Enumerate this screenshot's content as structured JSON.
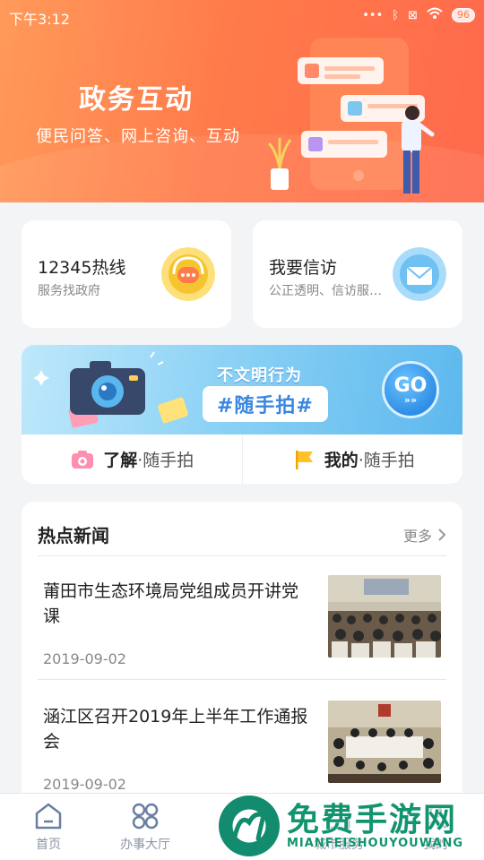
{
  "status_bar": {
    "time": "下午3:12",
    "battery": "96"
  },
  "hero": {
    "title": "政务互动",
    "subtitle": "便民问答、网上咨询、互动"
  },
  "quick_cards": [
    {
      "title": "12345热线",
      "subtitle": "服务找政府",
      "icon": "headset-chat-icon",
      "color": "#f7c431"
    },
    {
      "title": "我要信访",
      "subtitle": "公正透明、信访服…",
      "icon": "envelope-icon",
      "color": "#6fc0f3"
    }
  ],
  "banner": {
    "top_text": "不文明行为",
    "tag_text": "#随手拍#",
    "go_label": "GO",
    "go_arrows": "»»",
    "actions": [
      {
        "strong": "了解",
        "light": "·随手拍",
        "icon": "camera-icon"
      },
      {
        "strong": "我的",
        "light": "·随手拍",
        "icon": "flag-icon"
      }
    ]
  },
  "news": {
    "header": "热点新闻",
    "more_label": "更多",
    "items": [
      {
        "title": "莆田市生态环境局党组成员开讲党课",
        "date": "2019-09-02"
      },
      {
        "title": "涵江区召开2019年上半年工作通报会",
        "date": "2019-09-02"
      }
    ]
  },
  "tabbar": {
    "items": [
      {
        "label": "首页",
        "icon": "home-icon"
      },
      {
        "label": "办事大厅",
        "icon": "grid-icon"
      },
      {
        "label": "",
        "icon": "center-icon"
      },
      {
        "label": "城市服务",
        "icon": "city-icon"
      },
      {
        "label": "我的",
        "icon": "user-icon"
      }
    ]
  },
  "watermark": {
    "text": "免费手游网",
    "sub": "MIANFEISHOUYOUWANG"
  }
}
